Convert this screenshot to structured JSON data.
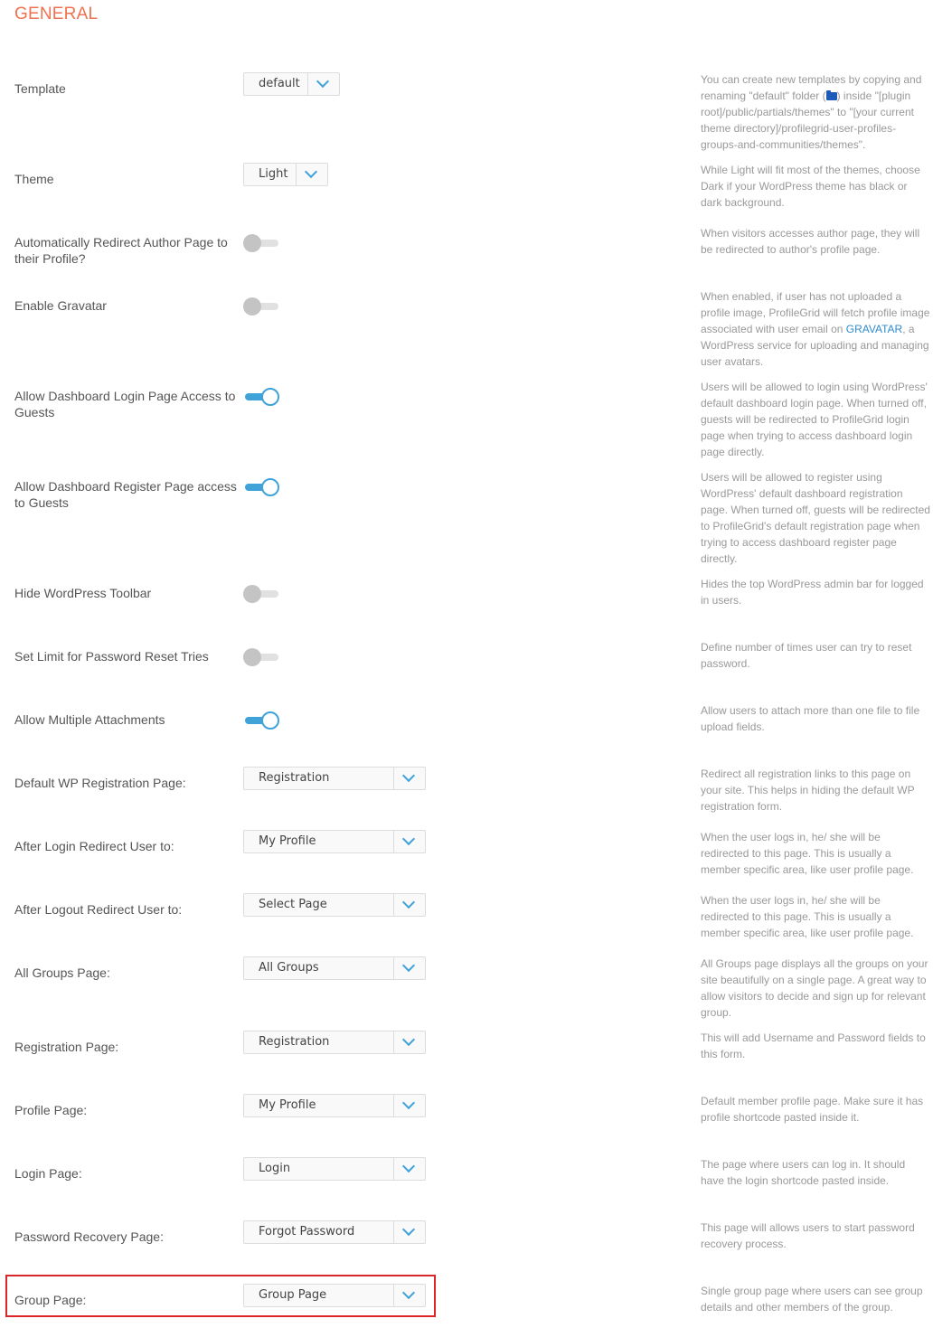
{
  "section_title": "GENERAL",
  "rows": {
    "template": {
      "label": "Template",
      "value": "default",
      "help_part1": "You can create new templates by copying and renaming \"default\" folder (",
      "help_part2": ") inside \"[plugin root]/public/partials/themes\" to \"[your current theme directory]/profilegrid-user-profiles-groups-and-communities/themes\".",
      "help_icon": "folder-icon"
    },
    "theme": {
      "label": "Theme",
      "value": "Light",
      "help": "While Light will fit most of the themes, choose Dark if your WordPress theme has black or dark background."
    },
    "redirect_author": {
      "label": "Automatically Redirect Author Page to their Profile?",
      "enabled": false,
      "help": "When visitors accesses author page, they will be redirected to author's profile page."
    },
    "gravatar": {
      "label": "Enable Gravatar",
      "enabled": false,
      "help_part1": "When enabled, if user has not uploaded a profile image, ProfileGrid will fetch profile image associated with user email on ",
      "help_link": "GRAVATAR",
      "help_part2": ", a WordPress service for uploading and managing user avatars."
    },
    "dashboard_login": {
      "label": "Allow Dashboard Login Page Access to Guests",
      "enabled": true,
      "help": "Users will be allowed to login using WordPress' default dashboard login page. When turned off, guests will be redirected to ProfileGrid login page when trying to access dashboard login page directly."
    },
    "dashboard_register": {
      "label": "Allow Dashboard Register Page access to Guests",
      "enabled": true,
      "help": "Users will be allowed to register using WordPress' default dashboard registration page. When turned off, guests will be redirected to ProfileGrid's default registration page when trying to access dashboard register page directly."
    },
    "hide_toolbar": {
      "label": "Hide WordPress Toolbar",
      "enabled": false,
      "help": "Hides the top WordPress admin bar for logged in users."
    },
    "password_reset_limit": {
      "label": "Set Limit for Password Reset Tries",
      "enabled": false,
      "help": "Define number of times user can try to reset password."
    },
    "multiple_attachments": {
      "label": "Allow Multiple Attachments",
      "enabled": true,
      "help": "Allow users to attach more than one file to file upload fields."
    },
    "default_wp_registration": {
      "label": "Default WP Registration Page:",
      "value": "Registration",
      "help": "Redirect all registration links to this page on your site. This helps in hiding the default WP registration form."
    },
    "after_login_redirect": {
      "label": "After Login Redirect User to:",
      "value": "My Profile",
      "help": "When the user logs in, he/ she will be redirected to this page. This is usually a member specific area, like user profile page."
    },
    "after_logout_redirect": {
      "label": "After Logout Redirect User to:",
      "value": "Select Page",
      "help": "When the user logs in, he/ she will be redirected to this page. This is usually a member specific area, like user profile page."
    },
    "all_groups_page": {
      "label": "All Groups Page:",
      "value": "All Groups",
      "help": "All Groups page displays all the groups on your site beautifully on a single page. A great way to allow visitors to decide and sign up for relevant group."
    },
    "registration_page": {
      "label": "Registration Page:",
      "value": "Registration",
      "help": "This will add Username and Password fields to this form."
    },
    "profile_page": {
      "label": "Profile Page:",
      "value": "My Profile",
      "help": "Default member profile page. Make sure it has profile shortcode pasted inside it."
    },
    "login_page": {
      "label": "Login Page:",
      "value": "Login",
      "help": "The page where users can log in. It should have the login shortcode pasted inside."
    },
    "password_recovery_page": {
      "label": "Password Recovery Page:",
      "value": "Forgot Password",
      "help": "This page will allows users to start password recovery process."
    },
    "group_page": {
      "label": "Group Page:",
      "value": "Group Page",
      "help": "Single group page where users can see group details and other members of the group.",
      "highlighted": true
    }
  },
  "colors": {
    "section_title": "#f0714f",
    "accent": "#3fa2d8",
    "highlight_border": "#d9262a",
    "help_text": "#999999"
  }
}
